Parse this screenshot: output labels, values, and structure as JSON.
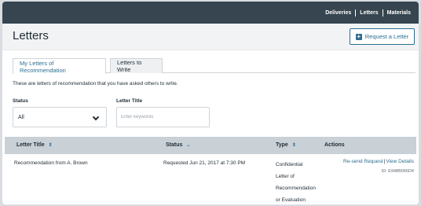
{
  "nav": {
    "items": [
      "Deliveries",
      "Letters",
      "Materials"
    ]
  },
  "header": {
    "title": "Letters",
    "request_button": "Request a Letter"
  },
  "tabs": [
    {
      "label": "My Letters of Recommendation",
      "active": true
    },
    {
      "label": "Letters to Write",
      "active": false
    }
  ],
  "description": "These are letters of recommendation that you have asked others to write.",
  "filters": {
    "status_label": "Status",
    "status_value": "All",
    "title_label": "Letter Title",
    "title_placeholder": "Enter keywords"
  },
  "table": {
    "columns": [
      "Letter Title",
      "Status",
      "Type",
      "Actions"
    ],
    "rows": [
      {
        "title": "Recommendation from A. Brown",
        "status": "Requested Jun 21, 2017 at 7:30 PM",
        "type_lines": [
          "Confidential",
          "Letter of",
          "Recommendation",
          "or Evaluation"
        ],
        "actions": [
          "Re-send Request",
          "View Details"
        ],
        "id": "ID: E948B066D4"
      }
    ]
  },
  "colors": {
    "nav_bg": "#36454f",
    "accent": "#2d6e91",
    "table_header_bg": "#c9d0d6"
  }
}
